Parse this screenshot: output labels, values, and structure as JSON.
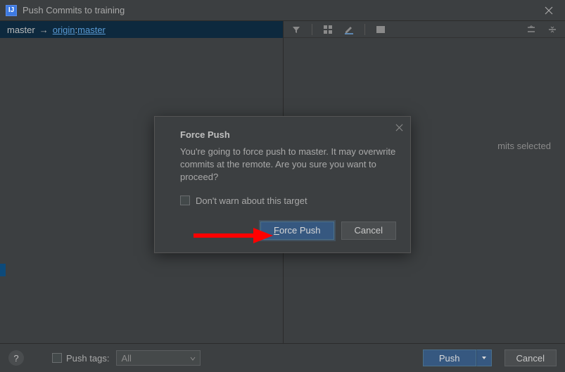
{
  "window": {
    "title": "Push Commits to training"
  },
  "branch": {
    "local": "master",
    "remote": "origin",
    "remote_branch": "master",
    "separator": "→",
    "colon": " : "
  },
  "right": {
    "no_commits": "mits selected"
  },
  "footer": {
    "push_tags_label": "Push tags:",
    "push_tags_value": "All",
    "push_button": "Push",
    "cancel_button": "Cancel",
    "help": "?"
  },
  "modal": {
    "title": "Force Push",
    "message": "You're going to force push to master. It may overwrite commits at the remote. Are you sure you want to proceed?",
    "checkbox_label": "Don't warn about this target",
    "primary_prefix": "F",
    "primary_rest": "orce Push",
    "cancel": "Cancel"
  }
}
